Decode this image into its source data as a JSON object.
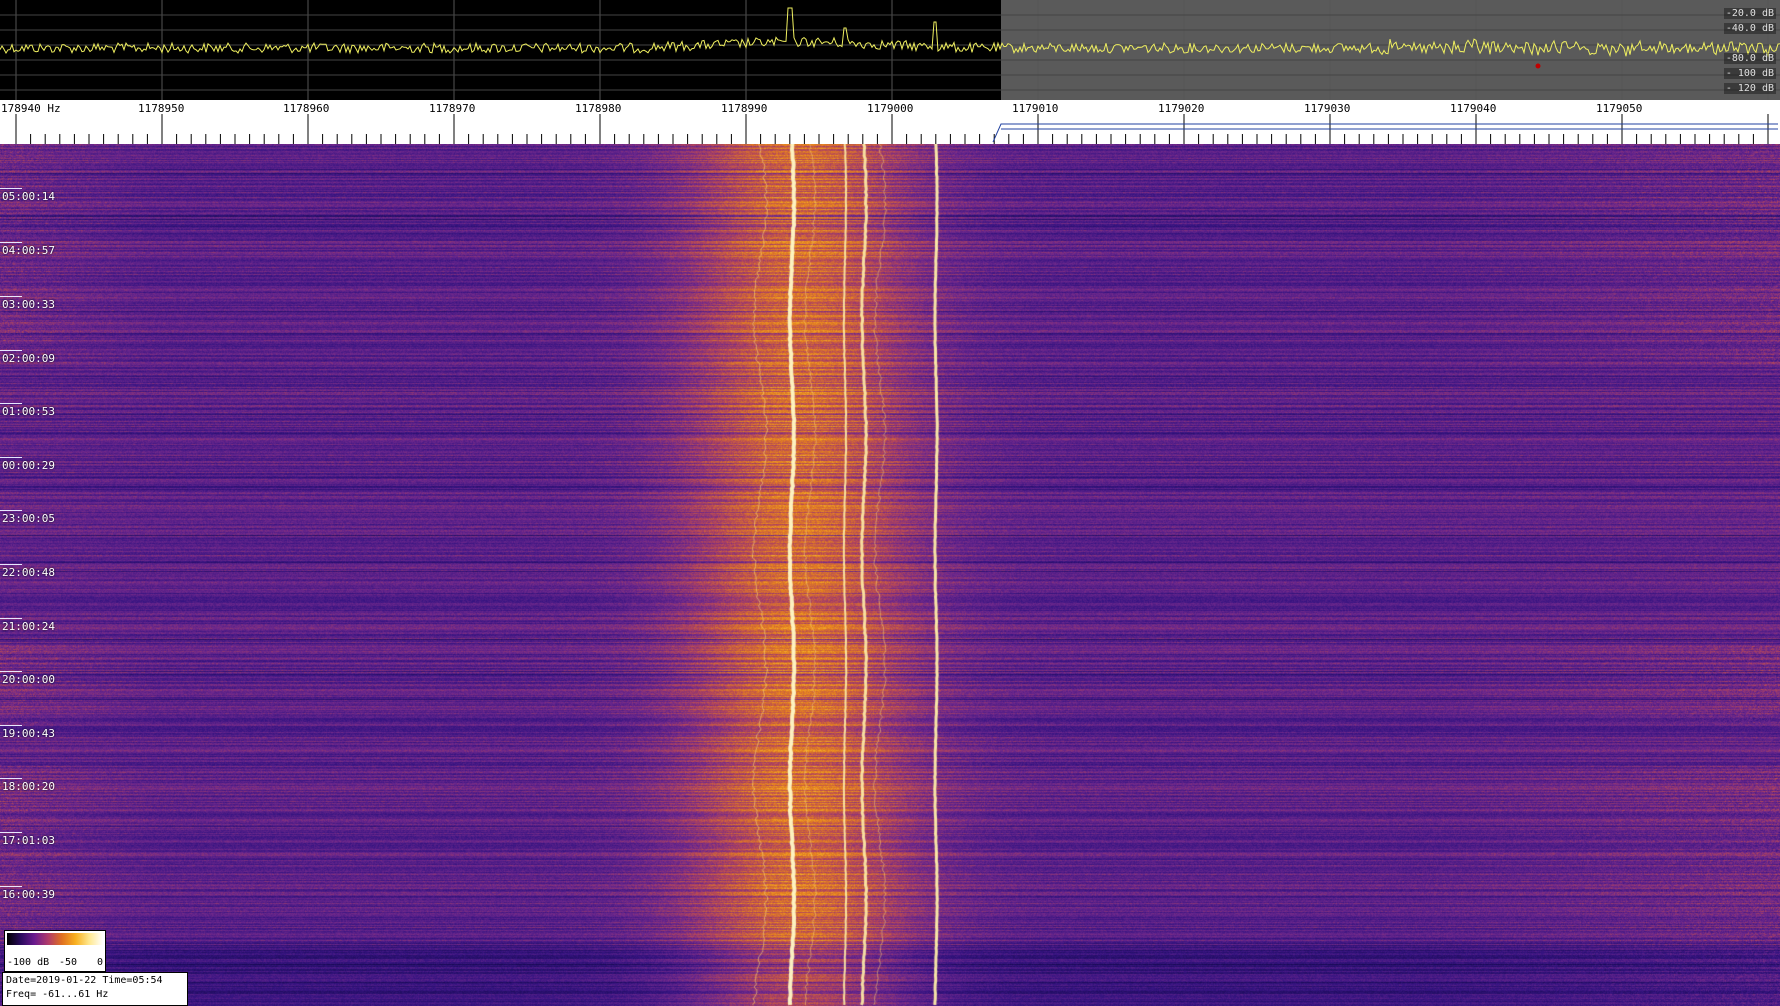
{
  "spectrum": {
    "db_labels": [
      "-20.0 dB",
      "-40.0 dB",
      "-80.0 dB",
      "- 100 dB",
      "- 120 dB"
    ]
  },
  "freq_axis": {
    "labels": [
      "178940 Hz",
      "1178950",
      "1178960",
      "1178970",
      "1178980",
      "1178990",
      "1179000",
      "1179010",
      "1179020",
      "1179030",
      "1179040",
      "1179050"
    ]
  },
  "waterfall": {
    "time_labels": [
      "05:00:14",
      "04:00:57",
      "03:00:33",
      "02:00:09",
      "01:00:53",
      "00:00:29",
      "23:00:05",
      "22:00:48",
      "21:00:24",
      "20:00:00",
      "19:00:43",
      "18:00:20",
      "17:01:03",
      "16:00:39"
    ]
  },
  "colorbar": {
    "labels": [
      "-100 dB",
      "-50",
      "0"
    ]
  },
  "info": {
    "line1": "Date=2019-01-22 Time=05:54",
    "line2": "Freq= -61...61 Hz"
  },
  "colors": {
    "spectrum_trace": "#f0f060",
    "waterfall_low": "#2a0a6e",
    "waterfall_high": "#ffe070"
  }
}
